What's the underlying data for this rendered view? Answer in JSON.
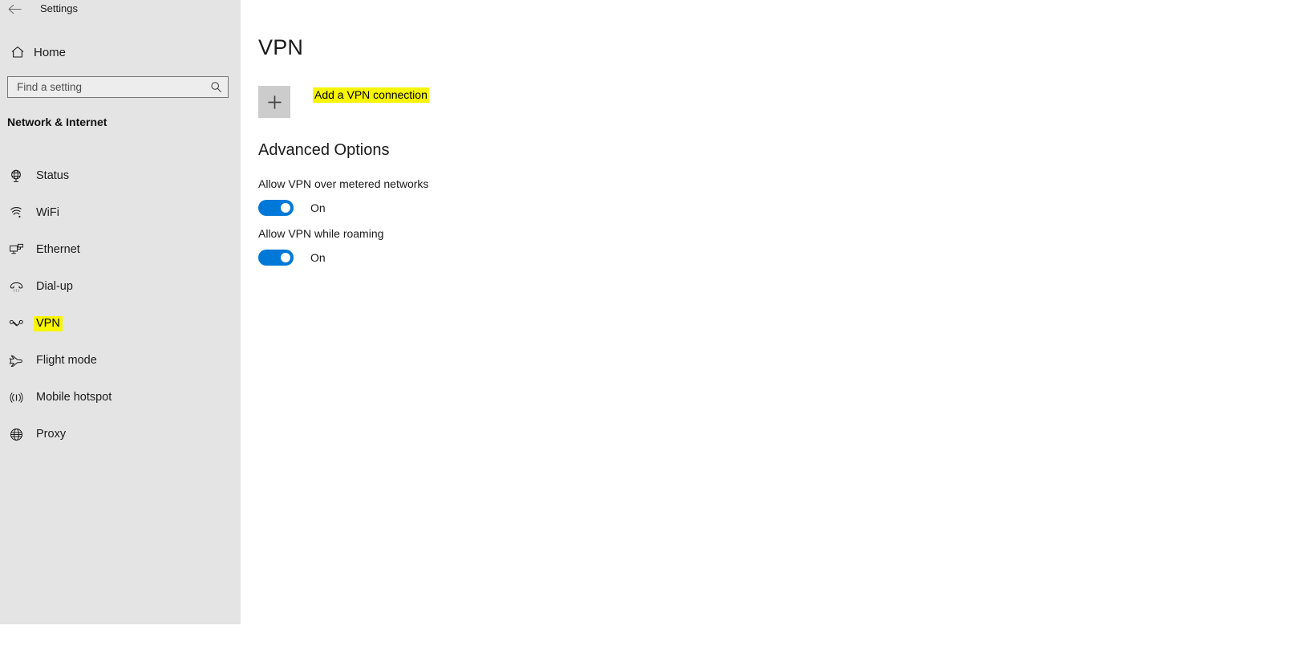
{
  "titlebar": {
    "back_icon": "back-arrow-icon",
    "title": "Settings"
  },
  "sidebar": {
    "home": {
      "label": "Home",
      "icon": "home-icon"
    },
    "search": {
      "placeholder": "Find a setting",
      "value": "",
      "icon": "search-icon"
    },
    "category_heading": "Network & Internet",
    "items": [
      {
        "label": "Status",
        "icon": "status-globe-icon",
        "highlighted": false
      },
      {
        "label": "WiFi",
        "icon": "wifi-icon",
        "highlighted": false
      },
      {
        "label": "Ethernet",
        "icon": "ethernet-icon",
        "highlighted": false
      },
      {
        "label": "Dial-up",
        "icon": "dialup-phone-icon",
        "highlighted": false
      },
      {
        "label": "VPN",
        "icon": "vpn-icon",
        "highlighted": true
      },
      {
        "label": "Flight mode",
        "icon": "airplane-icon",
        "highlighted": false
      },
      {
        "label": "Mobile hotspot",
        "icon": "hotspot-icon",
        "highlighted": false
      },
      {
        "label": "Proxy",
        "icon": "globe-icon",
        "highlighted": false
      }
    ]
  },
  "main": {
    "page_title": "VPN",
    "add_vpn": {
      "plus_icon": "plus-icon",
      "label": "Add a VPN connection",
      "highlighted": true
    },
    "advanced_heading": "Advanced Options",
    "settings": [
      {
        "label": "Allow VPN over metered networks",
        "state": "On",
        "on": true
      },
      {
        "label": "Allow VPN while roaming",
        "state": "On",
        "on": true
      }
    ]
  },
  "colors": {
    "sidebar_bg": "#e4e4e4",
    "content_bg": "#ffffff",
    "toggle_on": "#0078d7",
    "highlight": "#f7f500",
    "plus_button_bg": "#cccccc"
  }
}
